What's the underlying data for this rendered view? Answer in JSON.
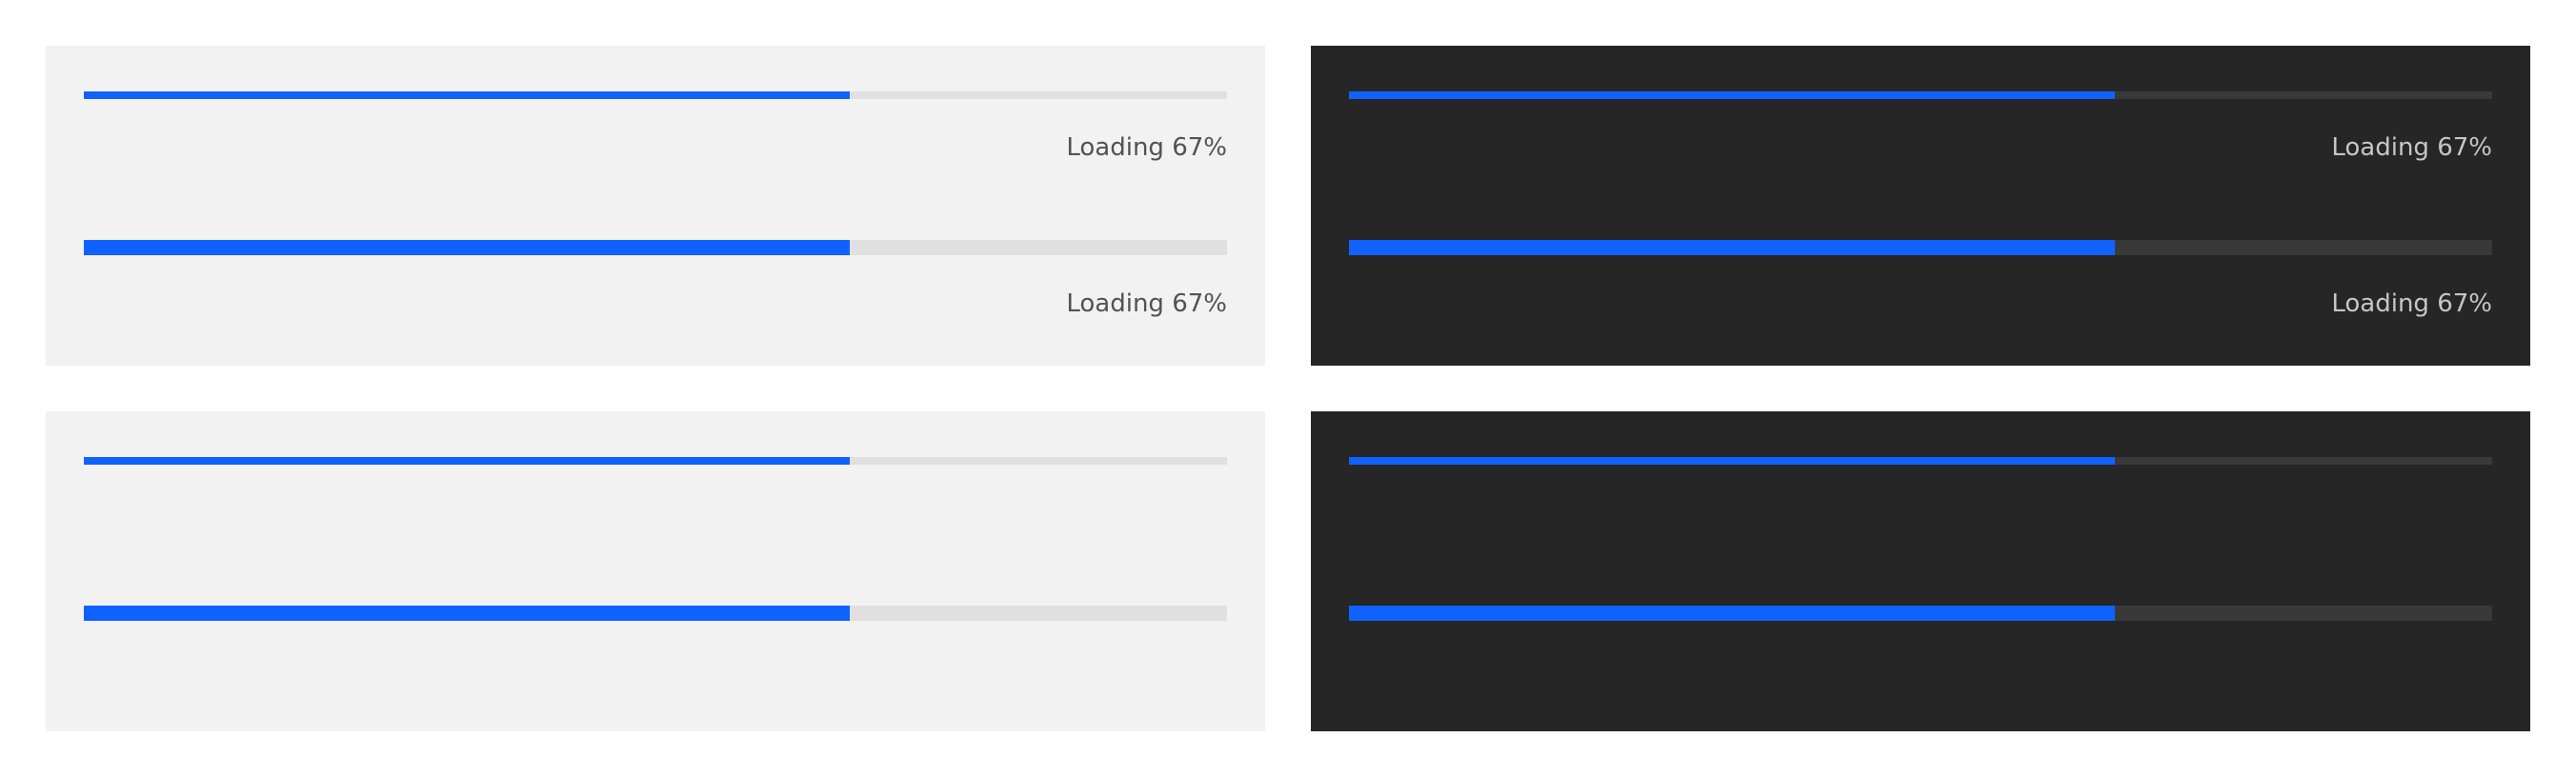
{
  "colors": {
    "page_background": "#ffffff",
    "light_panel_background": "#f2f2f2",
    "dark_panel_background": "#262626",
    "progress_fill": "#0f62fe",
    "light_track": "#e0e0e0",
    "dark_track": "#393939",
    "light_label": "#525252",
    "dark_label": "#c6c6c6"
  },
  "panels": [
    {
      "theme": "light",
      "bars": [
        {
          "value_percent": 67,
          "size": "small",
          "label": "Loading 67%"
        },
        {
          "value_percent": 67,
          "size": "big",
          "label": "Loading 67%"
        }
      ]
    },
    {
      "theme": "dark",
      "bars": [
        {
          "value_percent": 67,
          "size": "small",
          "label": "Loading 67%"
        },
        {
          "value_percent": 67,
          "size": "big",
          "label": "Loading 67%"
        }
      ]
    },
    {
      "theme": "light",
      "bars": [
        {
          "value_percent": 67,
          "size": "small"
        },
        {
          "value_percent": 67,
          "size": "big"
        }
      ]
    },
    {
      "theme": "dark",
      "bars": [
        {
          "value_percent": 67,
          "size": "small"
        },
        {
          "value_percent": 67,
          "size": "big"
        }
      ]
    }
  ]
}
